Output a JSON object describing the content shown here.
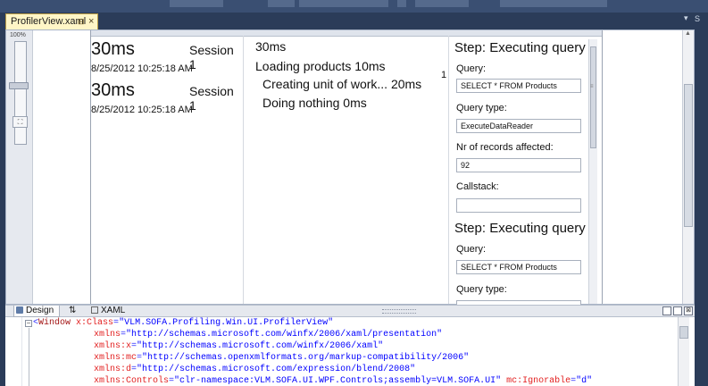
{
  "document_tab": {
    "title": "ProfilerView.xaml",
    "pin_icon": "pin-icon",
    "close_icon": "close-icon"
  },
  "zoom": {
    "level_label": "100%",
    "fit_label": "⛶"
  },
  "sessions": [
    {
      "duration": "30ms",
      "name": "Session 1",
      "date": "8/25/2012 10:25:18 AM"
    },
    {
      "duration": "30ms",
      "name": "Session 1",
      "date": "8/25/2012 10:25:18 AM"
    }
  ],
  "steps": {
    "total": "30ms",
    "items": [
      {
        "text": "Loading products  10ms",
        "indent": 0
      },
      {
        "text": "Creating unit of work...  20ms",
        "indent": 1
      },
      {
        "text": "Doing nothing  0ms",
        "indent": 1
      }
    ],
    "count_badge": "1"
  },
  "details": [
    {
      "title": "Step: Executing query",
      "fields": [
        {
          "label": "Query:",
          "value": "SELECT * FROM Products"
        },
        {
          "label": "Query type:",
          "value": "ExecuteDataReader"
        },
        {
          "label": "Nr of records affected:",
          "value": "92"
        },
        {
          "label": "Callstack:",
          "value": ""
        }
      ]
    },
    {
      "title": "Step: Executing query",
      "fields": [
        {
          "label": "Query:",
          "value": "SELECT * FROM Products"
        },
        {
          "label": "Query type:",
          "value": ""
        }
      ]
    }
  ],
  "split_tabs": {
    "design": "Design",
    "swap": "⇅",
    "xaml": "XAML"
  },
  "xaml_code": {
    "line1": {
      "bracket": "<",
      "element": "Window",
      "attr": " x:Class",
      "eq": "=",
      "value": "\"VLM.SOFA.Profiling.Win.UI.ProfilerView\""
    },
    "lines": [
      {
        "attr": "xmlns",
        "value": "\"http://schemas.microsoft.com/winfx/2006/xaml/presentation\""
      },
      {
        "attr": "xmlns:x",
        "value": "\"http://schemas.microsoft.com/winfx/2006/xaml\""
      },
      {
        "attr": "xmlns:mc",
        "value": "\"http://schemas.openxmlformats.org/markup-compatibility/2006\""
      },
      {
        "attr": "xmlns:d",
        "value": "\"http://schemas.microsoft.com/expression/blend/2008\""
      },
      {
        "attr": "xmlns:Controls",
        "value": "\"clr-namespace:VLM.SOFA.UI.WPF.Controls;assembly=VLM.SOFA.UI\"",
        "attr2": " mc:Ignorable",
        "value2": "\"d\""
      }
    ]
  },
  "colors": {
    "ide_background": "#2b3c59",
    "active_tab": "#fff6c7",
    "xaml_element": "#a31515",
    "xaml_attribute": "#e21f1f",
    "xaml_value": "#0000ff"
  }
}
